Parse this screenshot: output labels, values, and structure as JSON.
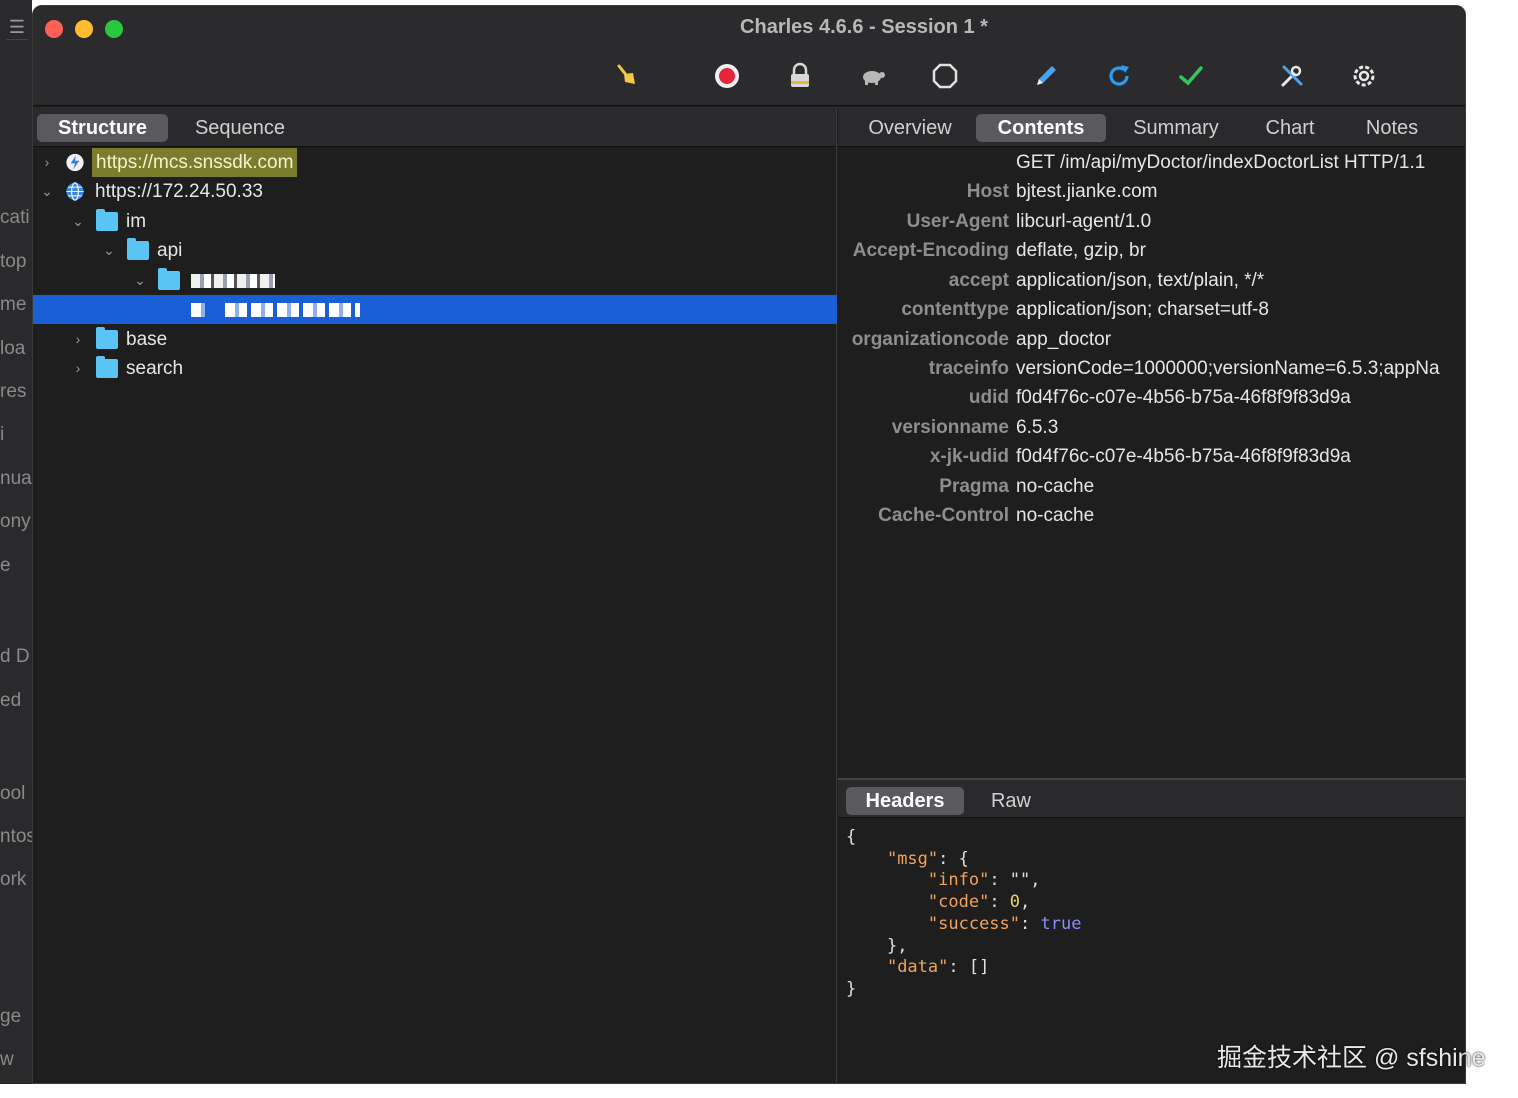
{
  "window": {
    "title": "Charles 4.6.6 - Session 1 *"
  },
  "background_window": {
    "words": [
      "cati",
      "top",
      "me",
      "loa",
      "res",
      "i",
      "nua",
      "ony",
      "e",
      "d D",
      "ed",
      "ool",
      "ntos",
      "ork",
      "ge",
      "w"
    ]
  },
  "toolbar": {
    "tools": [
      "broom-icon",
      "record-icon",
      "ssl-lock-icon",
      "turtle-throttle-icon",
      "stop-breakpoints-icon",
      "compose-pen-icon",
      "repeat-icon",
      "validate-check-icon",
      "tools-icon",
      "settings-gear-icon"
    ]
  },
  "left_tabs": {
    "structure": "Structure",
    "sequence": "Sequence"
  },
  "tree": {
    "host1": "https://mcs.snssdk.com",
    "host2": "https://172.24.50.33",
    "im": "im",
    "api": "api",
    "base": "base",
    "search": "search"
  },
  "right_tabs": {
    "overview": "Overview",
    "contents": "Contents",
    "summary": "Summary",
    "chart": "Chart",
    "notes": "Notes"
  },
  "request": {
    "request_line": "GET /im/api/myDoctor/indexDoctorList HTTP/1.1",
    "headers": [
      {
        "key": "Host",
        "value": "bjtest.jianke.com"
      },
      {
        "key": "User-Agent",
        "value": "libcurl-agent/1.0"
      },
      {
        "key": "Accept-Encoding",
        "value": "deflate, gzip, br"
      },
      {
        "key": "accept",
        "value": "application/json, text/plain, */*"
      },
      {
        "key": "contenttype",
        "value": "application/json; charset=utf-8"
      },
      {
        "key": "organizationcode",
        "value": "app_doctor"
      },
      {
        "key": "traceinfo",
        "value": "versionCode=1000000;versionName=6.5.3;appNa"
      },
      {
        "key": "udid",
        "value": "f0d4f76c-c07e-4b56-b75a-46f8f9f83d9a"
      },
      {
        "key": "versionname",
        "value": "6.5.3"
      },
      {
        "key": "x-jk-udid",
        "value": "f0d4f76c-c07e-4b56-b75a-46f8f9f83d9a"
      },
      {
        "key": "Pragma",
        "value": "no-cache"
      },
      {
        "key": "Cache-Control",
        "value": "no-cache"
      }
    ]
  },
  "bottom_tabs": {
    "headers": "Headers",
    "raw": "Raw"
  },
  "response_json": {
    "l1": "{",
    "msg_key": "\"msg\"",
    "msg_open": ": {",
    "info_key": "\"info\"",
    "info_val": ": \"\",",
    "code_key": "\"code\"",
    "code_val": "0",
    "success_key": "\"success\"",
    "success_val": "true",
    "msg_close": "},",
    "data_key": "\"data\"",
    "data_val": ": []",
    "l_end": "}"
  },
  "watermark": "掘金技术社区 @ sfshine"
}
